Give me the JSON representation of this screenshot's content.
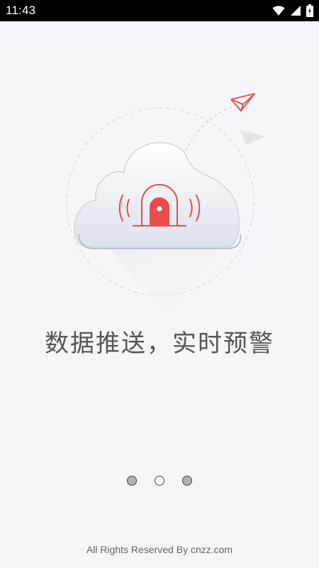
{
  "status_bar": {
    "time": "11:43",
    "icons": [
      "wifi-icon",
      "signal-icon",
      "battery-icon"
    ]
  },
  "onboarding": {
    "illustration": [
      "cloud-icon",
      "alarm-icon",
      "paper-plane-icon"
    ],
    "slogan": "数据推送，实时预警",
    "pager": {
      "page_count": 3,
      "active_pages": [
        1,
        3
      ]
    },
    "footer": "All Rights Reserved By cnzz.com"
  },
  "colors": {
    "background": "#f6f6fa",
    "status_bar": "#000000",
    "accent_red": "#e84c4c",
    "text": "#555555",
    "footer_text": "#666666",
    "dot_filled": "#b3b3b3"
  }
}
